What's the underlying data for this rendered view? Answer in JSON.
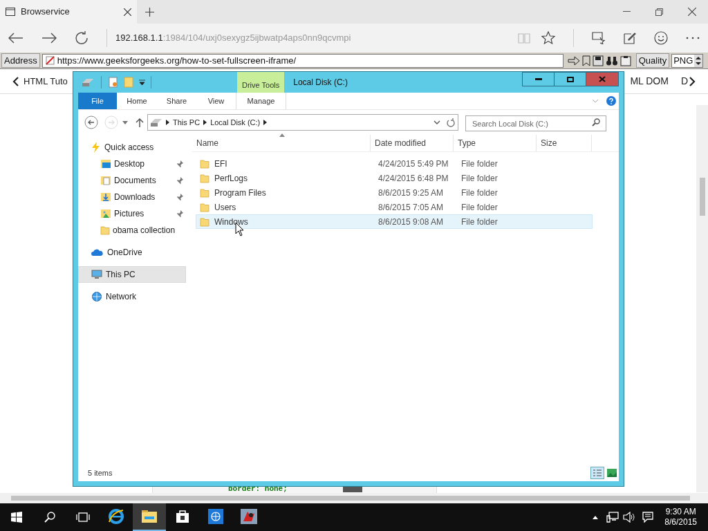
{
  "browser": {
    "tab_title": "Browservice",
    "address_host": "192.168.1.1",
    "address_path": ":1984/104/uxj0sexygz5ijbwatp4aps0nn9qcvmpi"
  },
  "toolbar": {
    "address_label": "Address",
    "url": "https://www.geeksforgeeks.org/how-to-set-fullscreen-iframe/",
    "quality_label": "Quality",
    "quality_value": "PNG"
  },
  "page": {
    "nav_left": "HTML Tuto",
    "nav_right": "ML DOM",
    "nav_right_cut": "D",
    "code": "border: none;"
  },
  "explorer": {
    "context_tab": "Drive Tools",
    "title": "Local Disk (C:)",
    "ribbon_tabs": [
      {
        "label": "File",
        "selected": true
      },
      {
        "label": "Home",
        "selected": false
      },
      {
        "label": "Share",
        "selected": false
      },
      {
        "label": "View",
        "selected": false
      },
      {
        "label": "Manage",
        "selected": false
      }
    ],
    "breadcrumb": [
      "This PC",
      "Local Disk (C:)"
    ],
    "search": {
      "placeholder": "Search Local Disk (C:)"
    },
    "nav": [
      {
        "label": "Quick access",
        "kind": "quick",
        "selected": false,
        "children": [
          {
            "label": "Desktop",
            "kind": "desktop",
            "pinned": true
          },
          {
            "label": "Documents",
            "kind": "documents",
            "pinned": true
          },
          {
            "label": "Downloads",
            "kind": "downloads",
            "pinned": true
          },
          {
            "label": "Pictures",
            "kind": "pictures",
            "pinned": true
          },
          {
            "label": "obama collection",
            "kind": "folder",
            "pinned": false
          }
        ]
      },
      {
        "label": "OneDrive",
        "kind": "cloud",
        "selected": false
      },
      {
        "label": "This PC",
        "kind": "pc",
        "selected": true
      },
      {
        "label": "Network",
        "kind": "network",
        "selected": false
      }
    ],
    "columns": [
      "Name",
      "Date modified",
      "Type",
      "Size"
    ],
    "rows": [
      {
        "name": "EFI",
        "date": "4/24/2015 5:49 PM",
        "type": "File folder",
        "selected": false
      },
      {
        "name": "PerfLogs",
        "date": "4/24/2015 6:48 PM",
        "type": "File folder",
        "selected": false
      },
      {
        "name": "Program Files",
        "date": "8/6/2015 9:25 AM",
        "type": "File folder",
        "selected": false
      },
      {
        "name": "Users",
        "date": "8/6/2015 7:05 AM",
        "type": "File folder",
        "selected": false
      },
      {
        "name": "Windows",
        "date": "8/6/2015 9:08 AM",
        "type": "File folder",
        "selected": true
      }
    ],
    "status": "5 items"
  },
  "taskbar": {
    "apps": [
      {
        "kind": "ie",
        "active": false
      },
      {
        "kind": "explorer",
        "active": true
      },
      {
        "kind": "store",
        "active": false
      },
      {
        "kind": "globe",
        "active": false
      },
      {
        "kind": "game",
        "active": false
      }
    ],
    "time": "9:30 AM",
    "date": "8/6/2015"
  }
}
